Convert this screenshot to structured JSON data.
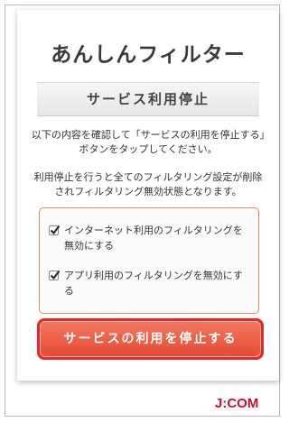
{
  "app": {
    "title": "あんしんフィルター",
    "section_title": "サービス利用停止"
  },
  "content": {
    "instruction": "以下の内容を確認して「サービスの利用を停止する」ボタンをタップしてください。",
    "warning": "利用停止を行うと全てのフィルタリング設定が削除されフィルタリング無効状態となります。"
  },
  "options": [
    {
      "label": "インターネット利用のフィルタリングを無効にする",
      "checked": true
    },
    {
      "label": "アプリ利用のフィルタリングを無効にする",
      "checked": true
    }
  ],
  "actions": {
    "stop_button_label": "サービスの利用を停止する"
  },
  "footer": {
    "logo_text": "J:COM"
  },
  "colors": {
    "accent": "#e64b33",
    "button_border": "#e4282d",
    "options_border": "#e08a6a",
    "logo": "#c8102e"
  }
}
